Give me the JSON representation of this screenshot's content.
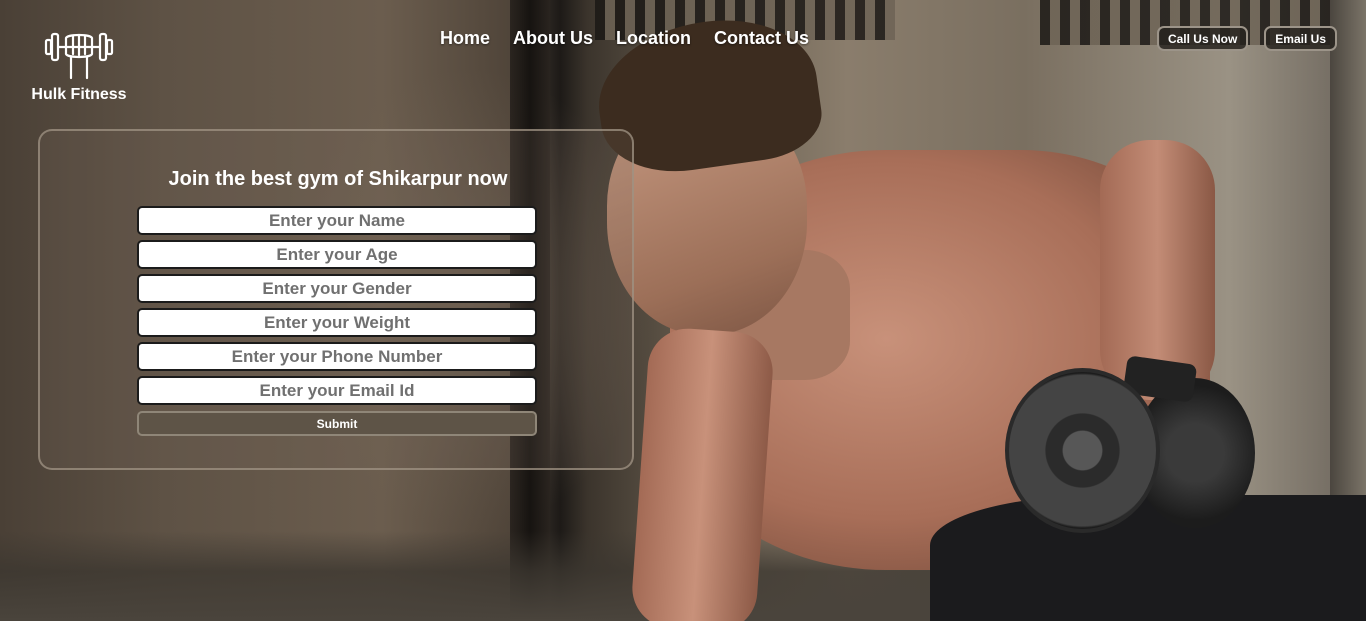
{
  "brand": {
    "name": "Hulk Fitness",
    "logo_icon": "dumbbell-fist-icon"
  },
  "nav": {
    "items": [
      {
        "label": "Home"
      },
      {
        "label": "About Us"
      },
      {
        "label": "Location"
      },
      {
        "label": "Contact Us"
      }
    ]
  },
  "actions": {
    "call_label": "Call Us Now",
    "email_label": "Email Us"
  },
  "form": {
    "title": "Join the best gym of Shikarpur now",
    "fields": {
      "name": {
        "placeholder": "Enter your Name",
        "value": ""
      },
      "age": {
        "placeholder": "Enter your Age",
        "value": ""
      },
      "gender": {
        "placeholder": "Enter your Gender",
        "value": ""
      },
      "weight": {
        "placeholder": "Enter your Weight",
        "value": ""
      },
      "phone": {
        "placeholder": "Enter your Phone Number",
        "value": ""
      },
      "email": {
        "placeholder": "Enter your Email Id",
        "value": ""
      }
    },
    "submit_label": "Submit"
  },
  "colors": {
    "text": "#ffffff",
    "button_bg": "#5e5447",
    "pill_border": "#9c9489",
    "card_border": "#a09484"
  }
}
